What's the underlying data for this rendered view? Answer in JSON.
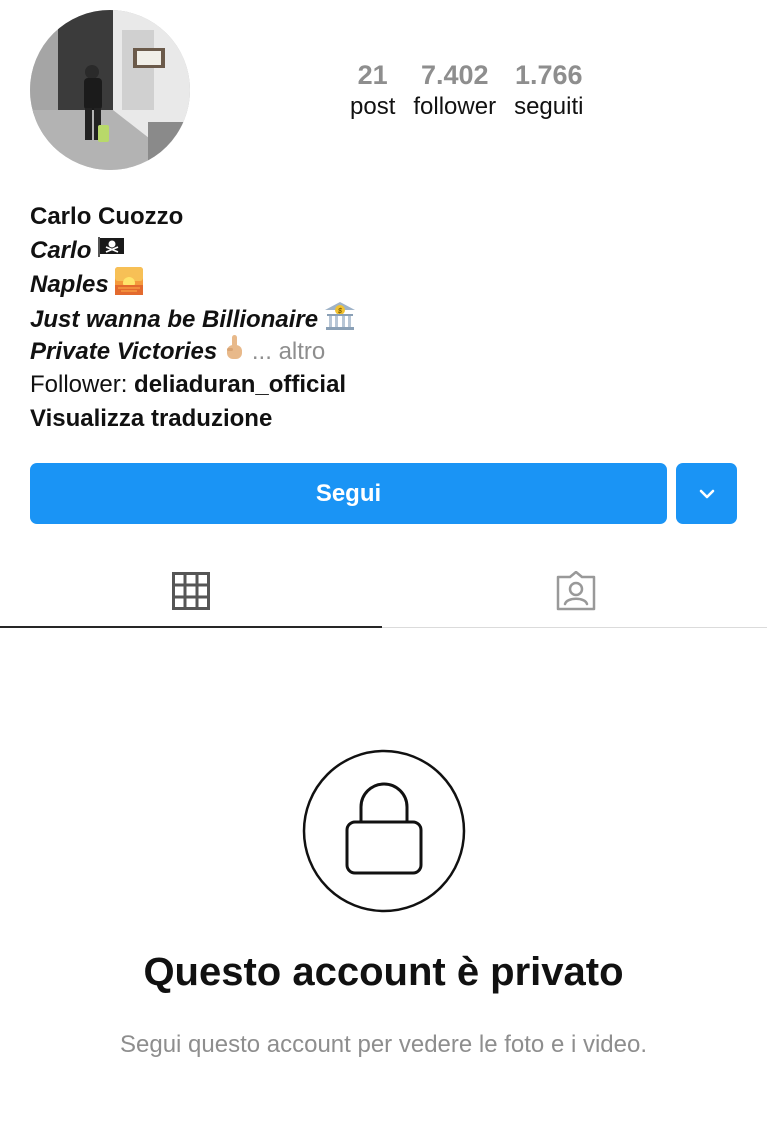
{
  "profile": {
    "avatar_icon": "profile-photo",
    "stats": [
      {
        "value": "21",
        "label": "post"
      },
      {
        "value": "7.402",
        "label": "follower"
      },
      {
        "value": "1.766",
        "label": "seguiti"
      }
    ],
    "name": "Carlo Cuozzo",
    "bio": {
      "line1": "Carlo",
      "line1_emoji": "pirate-flag-icon",
      "line2": "Naples",
      "line2_emoji": "sunset-icon",
      "line3": "Just wanna be Billionaire",
      "line3_emoji": "bank-icon",
      "line4": "Private Victories",
      "line4_emoji": "hand-gesture-icon",
      "more": "... altro"
    },
    "followed_by_label": "Follower: ",
    "followed_by_user": "deliaduran_official",
    "translate": "Visualizza traduzione"
  },
  "actions": {
    "follow_label": "Segui",
    "dropdown_icon": "chevron-down-icon"
  },
  "tabs": [
    {
      "icon": "grid-icon",
      "active": true
    },
    {
      "icon": "tagged-icon",
      "active": false
    }
  ],
  "private": {
    "icon": "lock-icon",
    "title": "Questo account è privato",
    "subtitle": "Segui questo account per vedere le foto e i video."
  },
  "colors": {
    "accent": "#1a94f5",
    "muted": "#8e8e8e",
    "text": "#111111"
  }
}
